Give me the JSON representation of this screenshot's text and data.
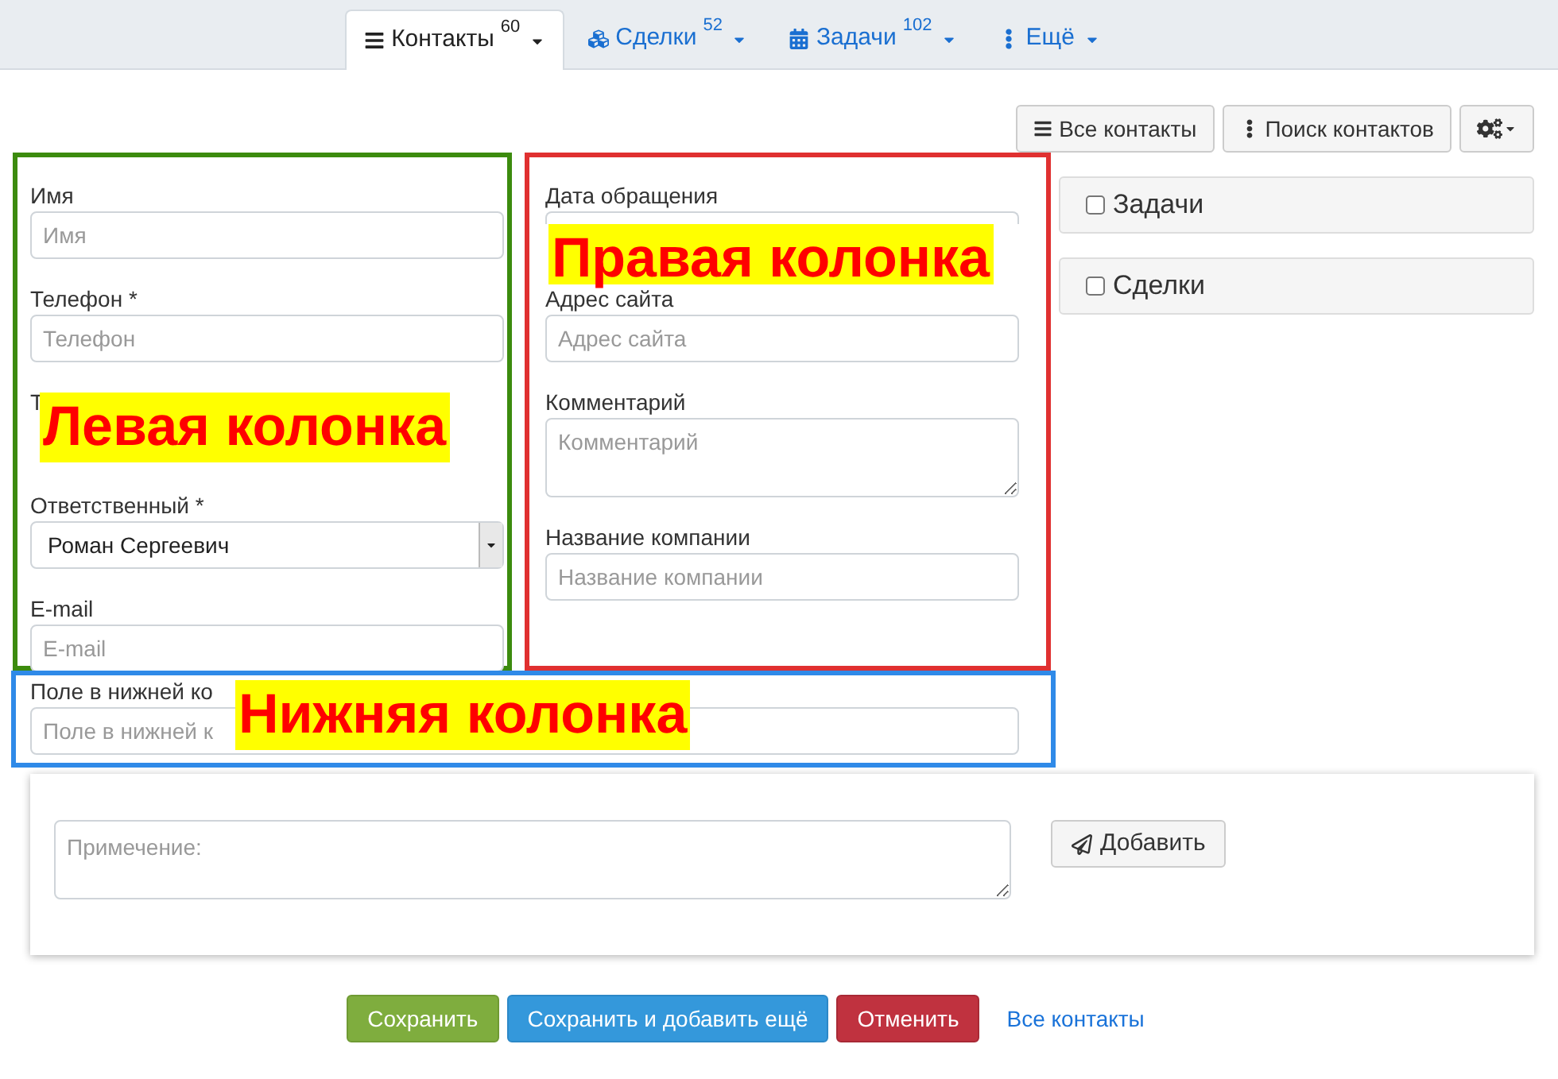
{
  "tabs": [
    {
      "kind": "list",
      "label": "Контакты",
      "count": "60",
      "selected": true
    },
    {
      "kind": "cubes",
      "label": "Сделки",
      "count": "52",
      "selected": false
    },
    {
      "kind": "calendar",
      "label": "Задачи",
      "count": "102",
      "selected": false
    },
    {
      "kind": "more",
      "label": "Ещё",
      "selected": false
    }
  ],
  "toolbar": [
    {
      "kind": "list",
      "label": "Все контакты"
    },
    {
      "kind": "more",
      "label": "Поиск контактов"
    },
    {
      "kind": "gear"
    }
  ],
  "left_column": {
    "annotation": "Левая колонка",
    "fields": [
      {
        "kind": "input",
        "label": "Имя",
        "placeholder": "Имя"
      },
      {
        "kind": "input",
        "label": "Телефон *",
        "placeholder": "Телефон"
      },
      {
        "kind": "covered",
        "label": "Т"
      },
      {
        "kind": "select",
        "label": "Ответственный *",
        "value": "Роман Сергеевич"
      },
      {
        "kind": "input",
        "label": "E-mail",
        "placeholder": "E-mail"
      }
    ]
  },
  "right_column": {
    "annotation": "Правая колонка",
    "fields": [
      {
        "kind": "partial",
        "label": "Дата обращения"
      },
      {
        "kind": "input",
        "label": "Адрес сайта",
        "placeholder": "Адрес сайта"
      },
      {
        "kind": "textarea",
        "label": "Комментарий",
        "placeholder": "Комментарий"
      },
      {
        "kind": "input",
        "label": "Название компании",
        "placeholder": "Название компании"
      }
    ]
  },
  "side_panels": [
    {
      "label": "Задачи",
      "checked": false
    },
    {
      "label": "Сделки",
      "checked": false
    }
  ],
  "bottom_column": {
    "annotation": "Нижняя колонка",
    "fields": [
      {
        "kind": "input",
        "label": "Поле в нижней ко",
        "placeholder": "Поле в нижней к"
      }
    ]
  },
  "note": {
    "placeholder": "Примечение:",
    "button": "Добавить"
  },
  "actions": [
    {
      "kind": "success",
      "label": "Сохранить"
    },
    {
      "kind": "primary",
      "label": "Сохранить и добавить ещё"
    },
    {
      "kind": "danger",
      "label": "Отменить"
    },
    {
      "kind": "link",
      "label": "Все контакты"
    }
  ]
}
